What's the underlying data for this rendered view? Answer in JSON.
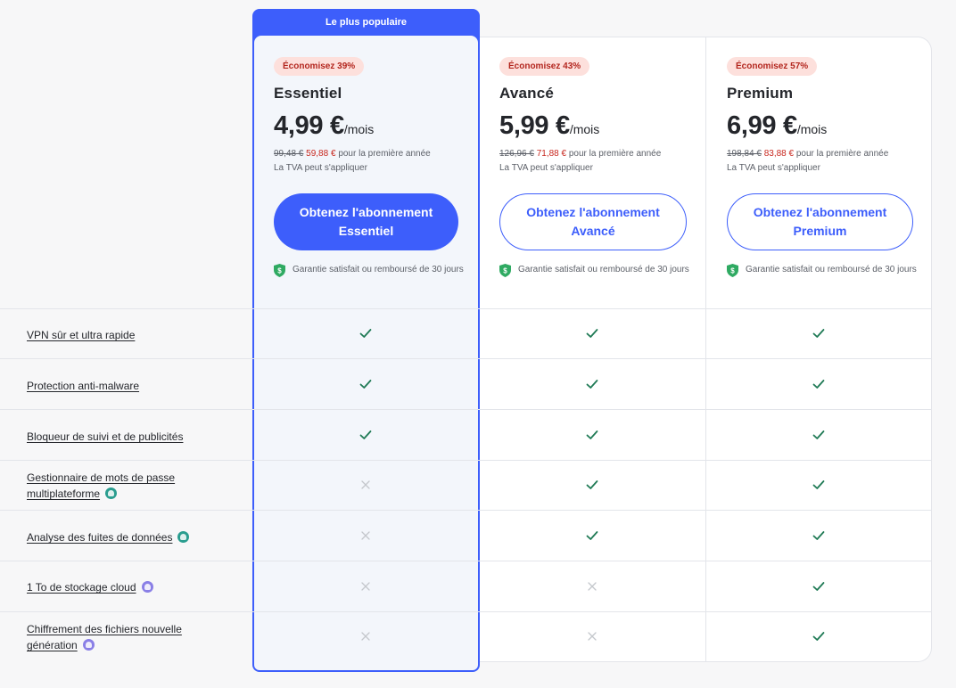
{
  "highlight_label": "Le plus populaire",
  "plans": [
    {
      "badge": "Économisez 39%",
      "name": "Essentiel",
      "price": "4,99 €",
      "per": "/mois",
      "old_price": "99,48 €",
      "new_price": "59,88 €",
      "price_suffix": "pour la première année",
      "vat": "La TVA peut s'appliquer",
      "cta_line1": "Obtenez l'abonnement",
      "cta_line2": "Essentiel",
      "guarantee": "Garantie satisfait ou remboursé de 30 jours",
      "features": [
        true,
        true,
        true,
        false,
        false,
        false,
        false
      ]
    },
    {
      "badge": "Économisez 43%",
      "name": "Avancé",
      "price": "5,99 €",
      "per": "/mois",
      "old_price": "126,96 €",
      "new_price": "71,88 €",
      "price_suffix": "pour la première année",
      "vat": "La TVA peut s'appliquer",
      "cta_line1": "Obtenez l'abonnement",
      "cta_line2": "Avancé",
      "guarantee": "Garantie satisfait ou remboursé de 30 jours",
      "features": [
        true,
        true,
        true,
        true,
        true,
        false,
        false
      ]
    },
    {
      "badge": "Économisez 57%",
      "name": "Premium",
      "price": "6,99 €",
      "per": "/mois",
      "old_price": "198,84 €",
      "new_price": "83,88 €",
      "price_suffix": "pour la première année",
      "vat": "La TVA peut s'appliquer",
      "cta_line1": "Obtenez l'abonnement",
      "cta_line2": "Premium",
      "guarantee": "Garantie satisfait ou remboursé de 30 jours",
      "features": [
        true,
        true,
        true,
        true,
        true,
        true,
        true
      ]
    }
  ],
  "features": [
    {
      "label": "VPN sûr et ultra rapide",
      "addon": ""
    },
    {
      "label": "Protection anti-malware",
      "addon": ""
    },
    {
      "label": "Bloqueur de suivi et de publicités",
      "addon": ""
    },
    {
      "label": "Gestionnaire de mots de passe multiplateforme",
      "addon": "password-manager-addon-icon"
    },
    {
      "label": "Analyse des fuites de données",
      "addon": "data-breach-addon-icon"
    },
    {
      "label": "1 To de stockage cloud",
      "addon": "cloud-storage-addon-icon"
    },
    {
      "label": "Chiffrement des fichiers nouvelle génération",
      "addon": "file-encryption-addon-icon"
    }
  ],
  "colors": {
    "accent": "#3d5efb",
    "check": "#1f7a55",
    "cross": "#c4c7cc",
    "badge_bg": "#fde0dc",
    "badge_text": "#b3261e",
    "teal_addon": "#2a9d8f",
    "purple_addon": "#8a7fe6"
  }
}
